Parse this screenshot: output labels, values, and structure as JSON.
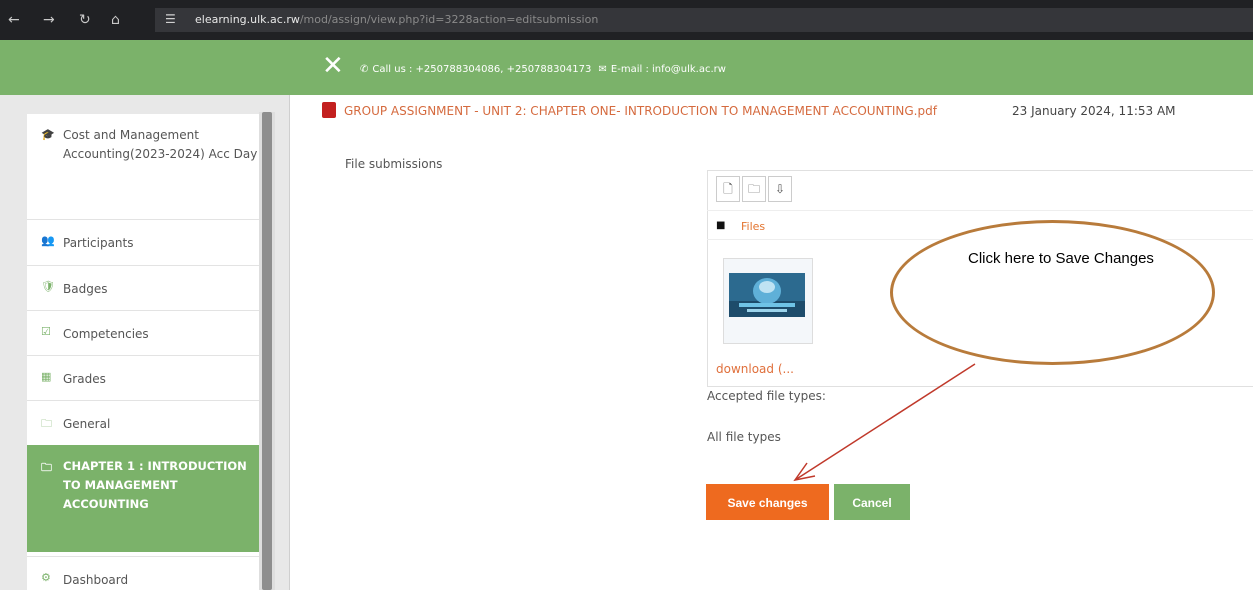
{
  "browser": {
    "url_domain": "elearning.ulk.ac.rw",
    "url_path": "/mod/assign/view.php?id=3228action=editsubmission"
  },
  "topbar": {
    "close_glyph": "✕",
    "phone_icon": "phone-icon",
    "contact_text": "Call us : +250788304086, +250788304173",
    "email_text": "E-mail : info@ulk.ac.rw"
  },
  "sidebar": {
    "items": [
      {
        "icon": "graduation-cap-icon",
        "glyph": "🎓",
        "label": "Cost and Management Accounting(2023-2024) Acc Day",
        "active": false
      },
      {
        "icon": "users-icon",
        "glyph": "👥",
        "label": "Participants",
        "active": false
      },
      {
        "icon": "badge-icon",
        "glyph": "🛡",
        "label": "Badges",
        "active": false
      },
      {
        "icon": "checkbox-icon",
        "glyph": "☑",
        "label": "Competencies",
        "active": false
      },
      {
        "icon": "grades-icon",
        "glyph": "▦",
        "label": "Grades",
        "active": false
      },
      {
        "icon": "folder-icon",
        "glyph": "🗀",
        "label": "General",
        "active": false
      },
      {
        "icon": "folder-icon",
        "glyph": "🗀",
        "label": "CHAPTER 1 : INTRODUCTION TO MANAGEMENT ACCOUNTING",
        "active": true
      },
      {
        "icon": "dashboard-icon",
        "glyph": "⚙",
        "label": "Dashboard",
        "active": false
      }
    ]
  },
  "main": {
    "file_name": "GROUP ASSIGNMENT - UNIT 2: CHAPTER ONE- INTRODUCTION TO MANAGEMENT ACCOUNTING.pdf",
    "file_date": "23 January 2024, 11:53 AM",
    "file_submissions_label": "File submissions",
    "files_crumb": "Files",
    "thumb_label": "download (...",
    "accepted_label": "Accepted file types:",
    "all_types": "All file types",
    "save_label": "Save changes",
    "cancel_label": "Cancel"
  },
  "annotation": {
    "callout_text": "Click here to Save Changes"
  },
  "colors": {
    "brand_green": "#7bb26a",
    "save_orange": "#ee6a1f",
    "link_orange": "#e0703c",
    "callout_border": "#b87b3b",
    "arrow": "#c0392b"
  }
}
